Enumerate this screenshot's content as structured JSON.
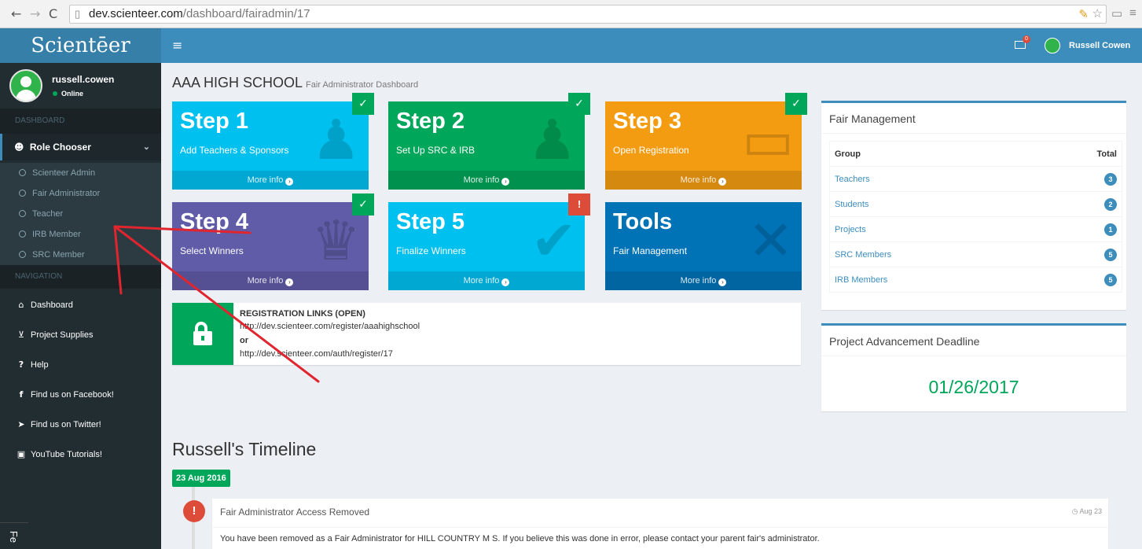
{
  "browser": {
    "url_host": "dev.scienteer.com",
    "url_path": "/dashboard/fairadmin/17"
  },
  "sidebar": {
    "logo": "Scientēer",
    "user": {
      "name": "russell.cowen",
      "status": "Online"
    },
    "dashboard_header": "DASHBOARD",
    "role_chooser": "Role Chooser",
    "roles": [
      "Scienteer Admin",
      "Fair Administrator",
      "Teacher",
      "IRB Member",
      "SRC Member"
    ],
    "navigation_header": "NAVIGATION",
    "nav_items": [
      {
        "label": "Dashboard",
        "icon": "home-icon"
      },
      {
        "label": "Project Supplies",
        "icon": "cart-icon"
      },
      {
        "label": "Help",
        "icon": "question-icon"
      },
      {
        "label": "Find us on Facebook!",
        "icon": "facebook-icon"
      },
      {
        "label": "Find us on Twitter!",
        "icon": "twitter-icon"
      },
      {
        "label": "YouTube Tutorials!",
        "icon": "youtube-icon"
      }
    ],
    "feedback_tab": "Fe"
  },
  "header": {
    "mail_count": "0",
    "user_name": "Russell Cowen"
  },
  "page": {
    "title": "AAA HIGH SCHOOL",
    "subtitle": "Fair Administrator Dashboard"
  },
  "tiles": [
    {
      "title": "Step 1",
      "subtitle": "Add Teachers & Sponsors",
      "footer": "More info",
      "status": "complete",
      "color": "#00c0ef",
      "icon": "add-user-icon"
    },
    {
      "title": "Step 2",
      "subtitle": "Set Up SRC & IRB",
      "footer": "More info",
      "status": "complete",
      "color": "#00a65a",
      "icon": "add-user-icon"
    },
    {
      "title": "Step 3",
      "subtitle": "Open Registration",
      "footer": "More info",
      "status": "complete",
      "color": "#f39c12",
      "icon": "laptop-icon"
    },
    {
      "title": "Step 4",
      "subtitle": "Select Winners",
      "footer": "More info",
      "status": "complete",
      "color": "#605ca8",
      "icon": "trophy-icon"
    },
    {
      "title": "Step 5",
      "subtitle": "Finalize Winners",
      "footer": "More info",
      "status": "warning",
      "color": "#00c0ef",
      "icon": "checkmark-icon"
    },
    {
      "title": "Tools",
      "subtitle": "Fair Management",
      "footer": "More info",
      "status": "none",
      "color": "#0073b7",
      "icon": "wrench-icon"
    }
  ],
  "status_marks": {
    "complete": "✓",
    "warning": "!"
  },
  "registration": {
    "title": "REGISTRATION LINKS (OPEN)",
    "link1": "http://dev.scienteer.com/register/aaahighschool",
    "or": "or",
    "link2": "http://dev.scienteer.com/auth/register/17"
  },
  "fair_management": {
    "title": "Fair Management",
    "col_group": "Group",
    "col_total": "Total",
    "rows": [
      {
        "group": "Teachers",
        "total": "3"
      },
      {
        "group": "Students",
        "total": "2"
      },
      {
        "group": "Projects",
        "total": "1"
      },
      {
        "group": "SRC Members",
        "total": "5"
      },
      {
        "group": "IRB Members",
        "total": "5"
      }
    ]
  },
  "deadline": {
    "title": "Project Advancement Deadline",
    "date": "01/26/2017"
  },
  "timeline": {
    "title": "Russell's Timeline",
    "date_label": "23 Aug 2016",
    "item": {
      "header": "Fair Administrator Access Removed",
      "time": "Aug 23",
      "body": "You have been removed as a Fair Administrator for HILL COUNTRY M S. If you believe this was done in error, please contact your parent fair's administrator."
    }
  },
  "colors": {
    "primary": "#3c8dbc",
    "success": "#00a65a",
    "danger": "#dd4b39",
    "sidebar": "#222d32",
    "annotation_arrow": "#e0252e"
  }
}
